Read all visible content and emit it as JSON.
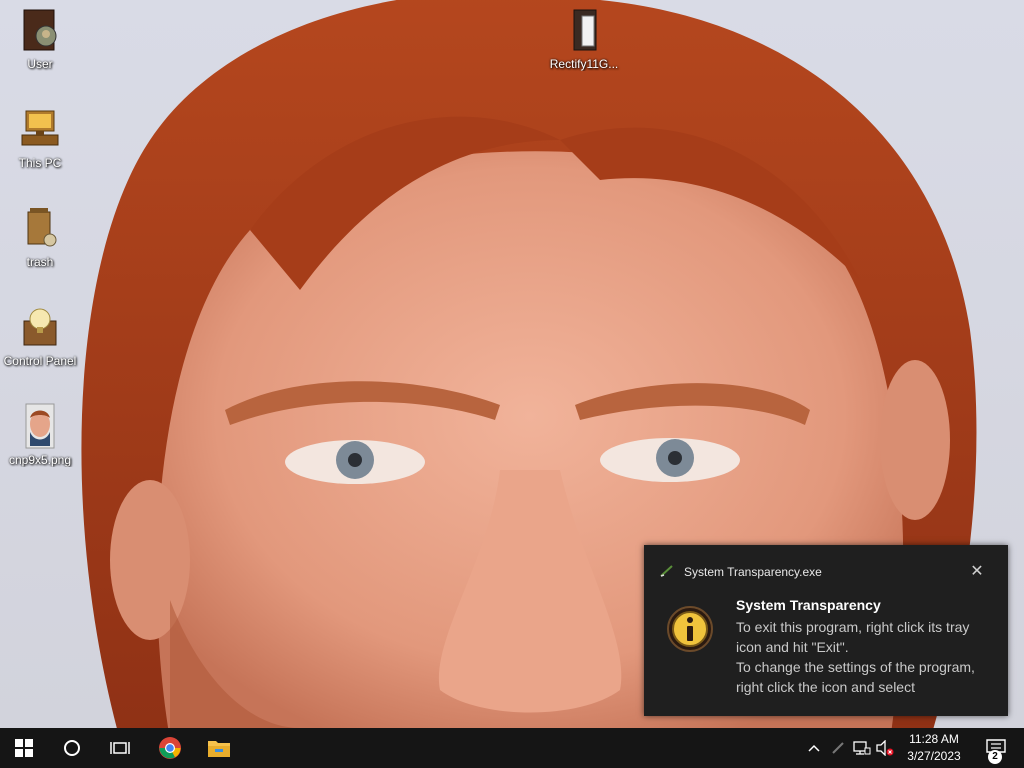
{
  "desktop": {
    "icons": [
      {
        "label": "User",
        "icon": "user-folder-icon"
      },
      {
        "label": "This PC",
        "icon": "computer-icon"
      },
      {
        "label": "trash",
        "icon": "trash-icon"
      },
      {
        "label": "Control Panel",
        "icon": "control-panel-icon"
      },
      {
        "label": "cnp9x5.png",
        "icon": "image-file-icon"
      },
      {
        "label": "Rectify11G...",
        "icon": "file-icon"
      }
    ]
  },
  "notification": {
    "app_name": "System Transparency.exe",
    "title": "System Transparency",
    "body_lines": [
      "To exit this program, right click its tray icon and hit \"Exit\".",
      "To change the settings of the program, right click the icon and select"
    ],
    "close_icon": "close-icon",
    "info_icon": "info-icon"
  },
  "taskbar": {
    "start_icon": "windows-start-icon",
    "search_icon": "search-circle-icon",
    "task_view_icon": "task-view-icon",
    "pinned": [
      {
        "name": "chrome",
        "icon": "chrome-icon"
      },
      {
        "name": "file-explorer",
        "icon": "folder-icon"
      }
    ],
    "tray": {
      "chevron_icon": "chevron-up-icon",
      "pen_icon": "pen-icon",
      "network_icon": "network-icon",
      "volume_icon": "volume-muted-icon"
    },
    "clock": {
      "time": "11:28 AM",
      "date": "3/27/2023"
    },
    "action_center_count": "2"
  },
  "colors": {
    "taskbar_bg": "#151515",
    "toast_bg": "#1f1f1f",
    "toast_body_text": "#c9c9c9"
  }
}
